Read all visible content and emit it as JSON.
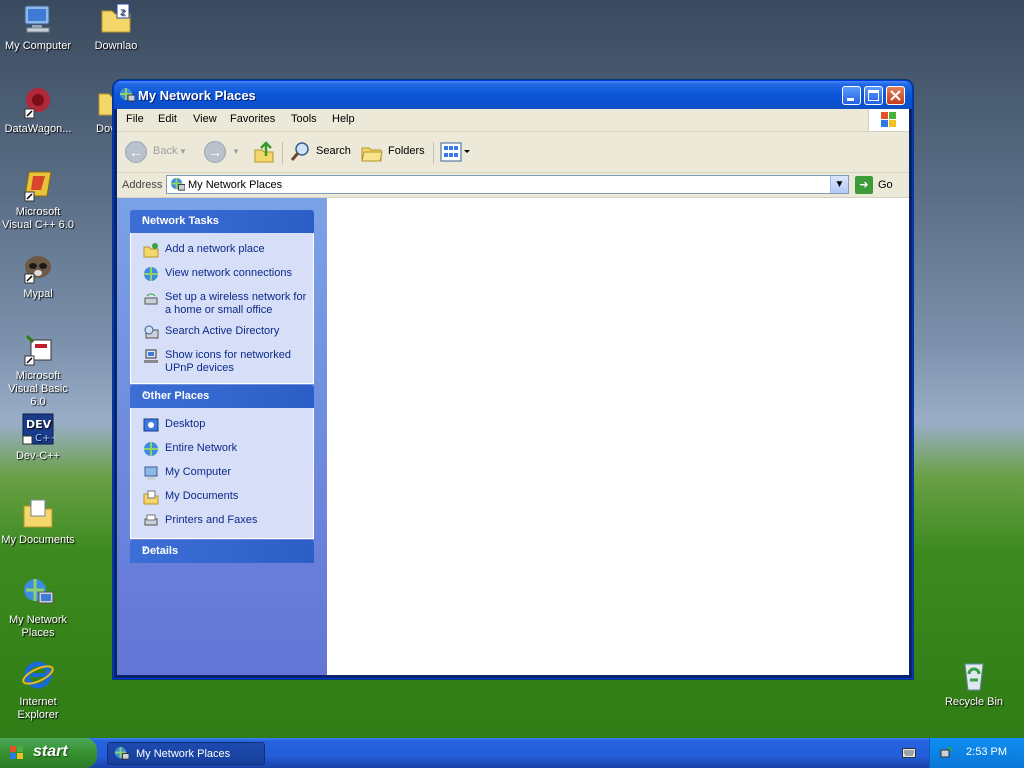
{
  "desktop": {
    "icons": [
      {
        "label": "My Computer"
      },
      {
        "label": "Downlao"
      },
      {
        "label": "DataWagon..."
      },
      {
        "label": "Dov"
      },
      {
        "label": "Microsoft Visual C++ 6.0"
      },
      {
        "label": "Mypal"
      },
      {
        "label": "Microsoft Visual Basic 6.0"
      },
      {
        "label": "Dev-C++"
      },
      {
        "label": "My Documents"
      },
      {
        "label": "My Network Places"
      },
      {
        "label": "Internet Explorer"
      },
      {
        "label": "Recycle Bin"
      }
    ]
  },
  "window": {
    "title": "My Network Places",
    "menu": [
      "File",
      "Edit",
      "View",
      "Favorites",
      "Tools",
      "Help"
    ],
    "toolbar": {
      "back_label": "Back",
      "search_label": "Search",
      "folders_label": "Folders"
    },
    "address": {
      "label": "Address",
      "value": "My Network Places",
      "go_label": "Go"
    },
    "network_tasks": {
      "title": "Network Tasks",
      "items": [
        "Add a network place",
        "View network connections",
        "Set up a wireless network for a home or small office",
        "Search Active Directory",
        "Show icons for networked UPnP devices"
      ]
    },
    "other_places": {
      "title": "Other Places",
      "items": [
        "Desktop",
        "Entire Network",
        "My Computer",
        "My Documents",
        "Printers and Faxes"
      ]
    },
    "details": {
      "title": "Details"
    }
  },
  "taskbar": {
    "start_label": "start",
    "items": [
      "My Network Places"
    ],
    "clock": "2:53 PM"
  },
  "colors": {
    "titlebar": "#0b57d8",
    "taskbar": "#245edb",
    "start": "#35912f",
    "sidebar": "#7ba2e7",
    "tray": "#0b77d8"
  }
}
